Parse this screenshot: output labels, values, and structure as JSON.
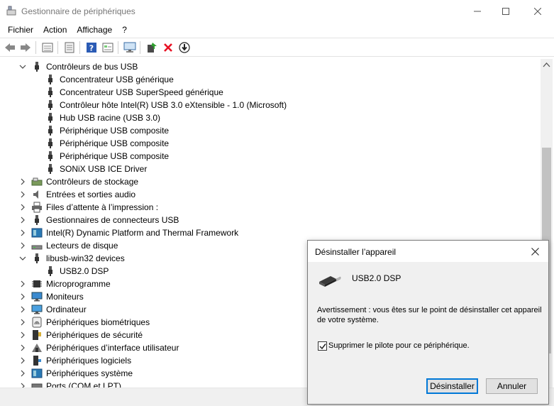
{
  "window": {
    "title": "Gestionnaire de périphériques"
  },
  "menu": [
    "Fichier",
    "Action",
    "Affichage",
    "?"
  ],
  "toolbar": {
    "buttons": [
      "back-arrow-icon",
      "forward-arrow-icon",
      "tree-view-icon",
      "properties-icon",
      "help-icon",
      "resource-view-icon",
      "scan-hardware-icon",
      "update-driver-icon",
      "uninstall-x-icon",
      "download-driver-icon"
    ]
  },
  "tree": {
    "usb_controllers": {
      "label": "Contrôleurs de bus USB",
      "children": [
        "Concentrateur USB générique",
        "Concentrateur USB SuperSpeed générique",
        "Contrôleur hôte Intel(R) USB 3.0 eXtensible - 1.0 (Microsoft)",
        "Hub USB racine (USB 3.0)",
        "Périphérique USB composite",
        "Périphérique USB composite",
        "Périphérique USB composite",
        "SONiX USB ICE Driver"
      ]
    },
    "categories_a": [
      "Contrôleurs de stockage",
      "Entrées et sorties audio",
      "Files d’attente à l’impression :",
      "Gestionnaires de connecteurs USB",
      "Intel(R) Dynamic Platform and Thermal Framework",
      "Lecteurs de disque"
    ],
    "libusb": {
      "label": "libusb-win32 devices",
      "children": [
        "USB2.0 DSP"
      ]
    },
    "categories_b": [
      "Microprogramme",
      "Moniteurs",
      "Ordinateur",
      "Périphériques biométriques",
      "Périphériques de sécurité",
      "Périphériques d’interface utilisateur",
      "Périphériques logiciels",
      "Périphériques système",
      "Ports (COM et LPT)"
    ]
  },
  "dialog": {
    "title": "Désinstaller l’appareil",
    "device_name": "USB2.0 DSP",
    "warning": "Avertissement : vous êtes sur le point de désinstaller cet appareil de votre système.",
    "checkbox_label": "Supprimer le pilote pour ce périphérique.",
    "checkbox_checked": true,
    "ok_label": "Désinstaller",
    "cancel_label": "Annuler"
  },
  "colors": {
    "accent": "#0078d7",
    "delete_red": "#e81123"
  }
}
